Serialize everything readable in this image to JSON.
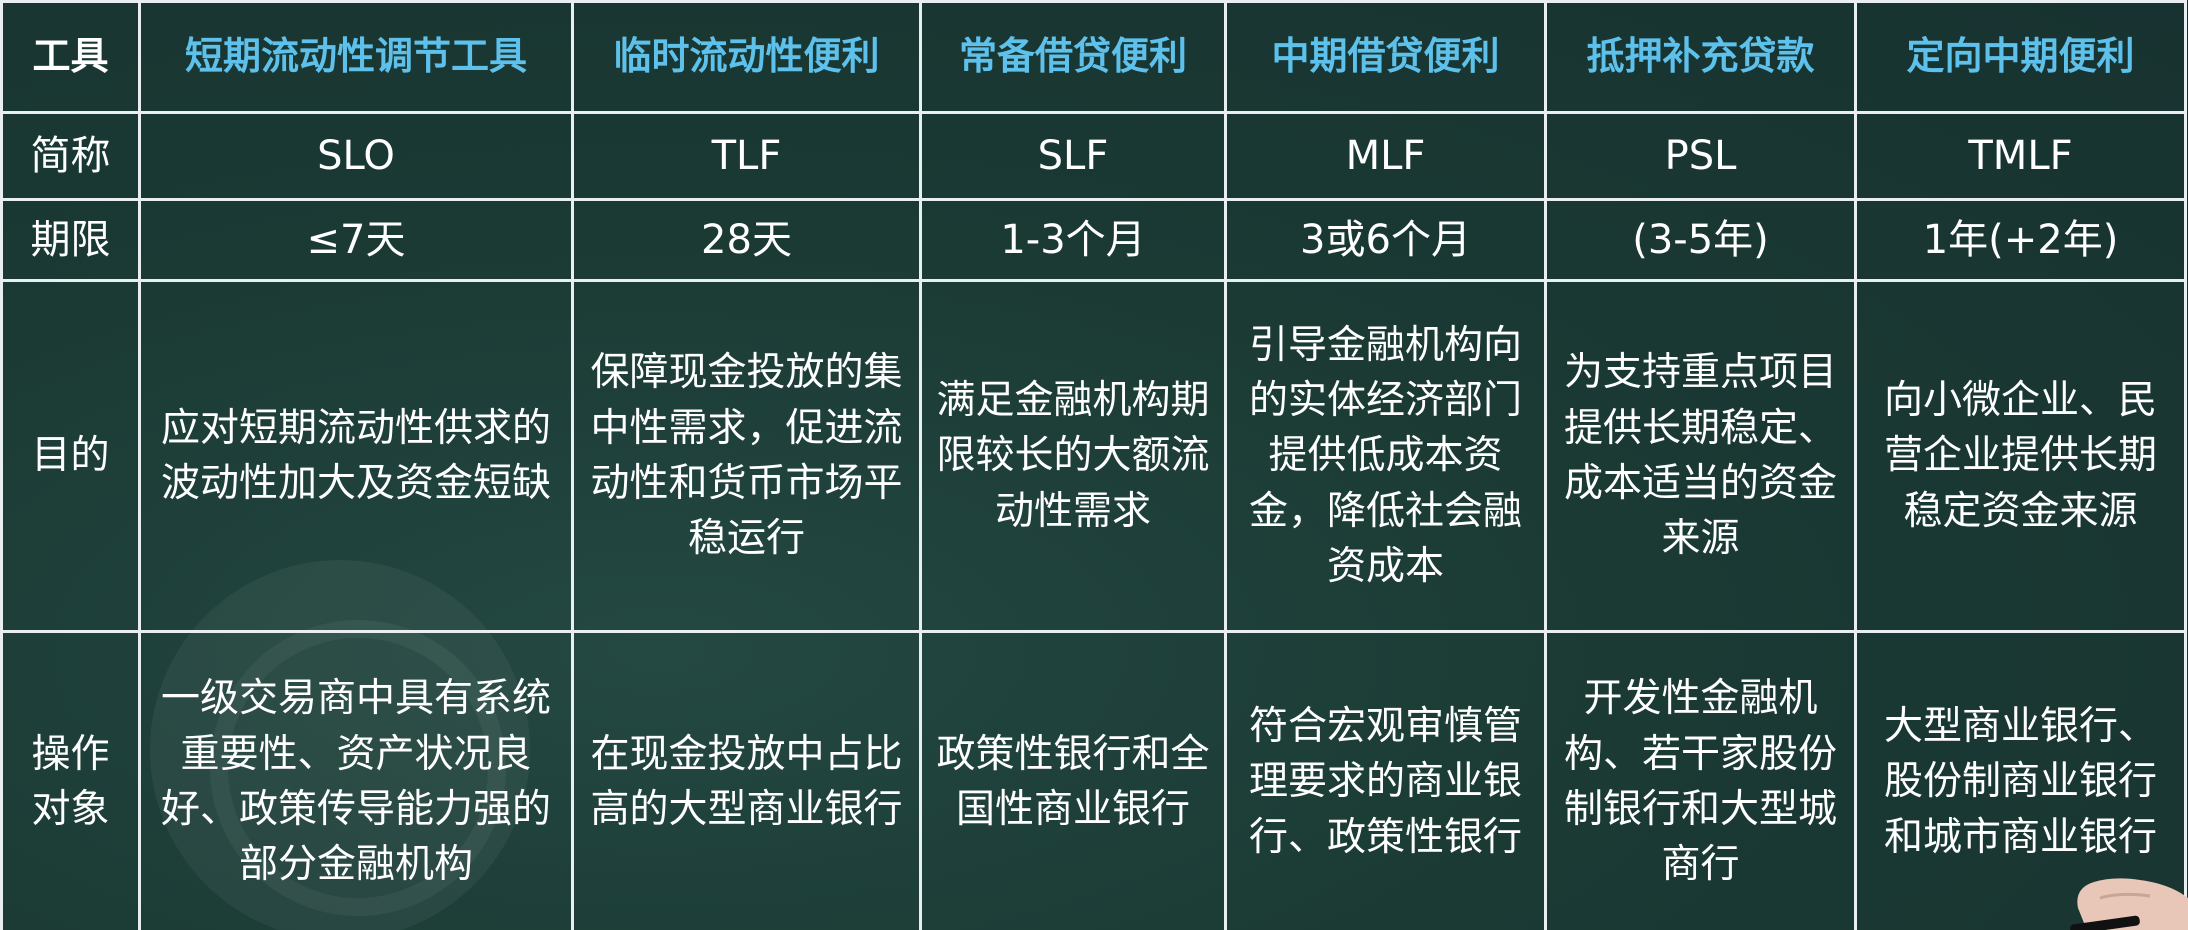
{
  "table": {
    "corner_label": "工具",
    "tools": [
      "短期流动性调节工具",
      "临时流动性便利",
      "常备借贷便利",
      "中期借贷便利",
      "抵押补充贷款",
      "定向中期便利"
    ],
    "rows": {
      "abbr": {
        "label": "简称",
        "values": [
          "SLO",
          "TLF",
          "SLF",
          "MLF",
          "PSL",
          "TMLF"
        ]
      },
      "term": {
        "label": "期限",
        "values": [
          "≤7天",
          "28天",
          "1-3个月",
          "3或6个月",
          "(3-5年)",
          "1年(+2年)"
        ]
      },
      "purpose": {
        "label": "目的",
        "values": [
          "应对短期流动性供求的波动性加大及资金短缺",
          "保障现金投放的集中性需求，促进流动性和货币市场平稳运行",
          "满足金融机构期限较长的大额流动性需求",
          "引导金融机构向的实体经济部门提供低成本资金，降低社会融资成本",
          "为支持重点项目提供长期稳定、成本适当的资金来源",
          "向小微企业、民营企业提供长期稳定资金来源"
        ]
      },
      "target": {
        "label": "操作对象",
        "values": [
          "一级交易商中具有系统重要性、资产状况良好、政策传导能力强的部分金融机构",
          "在现金投放中占比高的大型商业银行",
          "政策性银行和全国性商业银行",
          "符合宏观审慎管理要求的商业银行、政策性银行",
          "开发性金融机构、若干家股份制银行和大型城商行",
          "大型商业银行、股份制商业银行和城市商业银行"
        ]
      }
    }
  },
  "colors": {
    "background": "#1c3a35",
    "grid_line": "#e9eef0",
    "header_text": "#5dc1ec",
    "body_text": "#ffffff"
  }
}
